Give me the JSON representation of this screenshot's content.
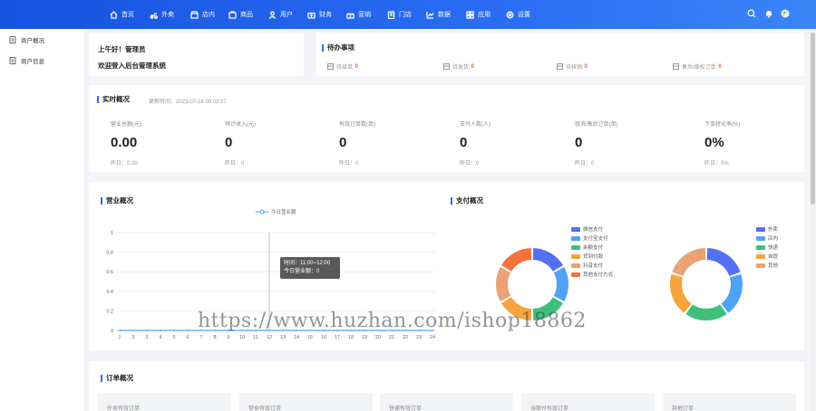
{
  "nav": {
    "items": [
      {
        "label": "首页",
        "icon": "home-icon"
      },
      {
        "label": "外卖",
        "icon": "delivery-icon"
      },
      {
        "label": "店内",
        "icon": "store-icon"
      },
      {
        "label": "商品",
        "icon": "goods-icon"
      },
      {
        "label": "用户",
        "icon": "user-icon"
      },
      {
        "label": "财务",
        "icon": "finance-icon"
      },
      {
        "label": "营销",
        "icon": "gift-icon"
      },
      {
        "label": "门店",
        "icon": "shop-icon"
      },
      {
        "label": "数据",
        "icon": "data-icon"
      },
      {
        "label": "应用",
        "icon": "apps-icon"
      },
      {
        "label": "设置",
        "icon": "gear-icon"
      }
    ],
    "right_icons": [
      "search-icon",
      "bell-icon",
      "avatar"
    ]
  },
  "sidebar": {
    "items": [
      {
        "label": "商户概况"
      },
      {
        "label": "商户信息"
      }
    ]
  },
  "welcome": {
    "line1": "上午好！管理员",
    "line2": "欢迎登入后台管理系统"
  },
  "todo": {
    "title": "待办事项",
    "items": [
      {
        "label": "待接单:",
        "value": "0"
      },
      {
        "label": "待发货:",
        "value": "0"
      },
      {
        "label": "待核销:",
        "value": "0"
      },
      {
        "label": "售后/维权订单:",
        "value": "0"
      }
    ]
  },
  "realtime": {
    "title": "实时概况",
    "update_time": "更新时间：2023-07-18 09:03:57",
    "stats": [
      {
        "label": "营业总额(元)",
        "value": "0.00",
        "compare": "昨日：0.00"
      },
      {
        "label": "预计收入(元)",
        "value": "0",
        "compare": "昨日：0"
      },
      {
        "label": "有效订单数(单)",
        "value": "0",
        "compare": "昨日：0"
      },
      {
        "label": "支付人数(人)",
        "value": "0",
        "compare": "昨日：0"
      },
      {
        "label": "取消/售后订单(单)",
        "value": "0",
        "compare": "昨日：0"
      },
      {
        "label": "下单转化率(%)",
        "value": "0%",
        "compare": "昨日：0%"
      }
    ]
  },
  "business": {
    "title": "营业概况",
    "legend": "今日营业额",
    "tooltip_time": "时间：11:00~12:00",
    "tooltip_value": "今日营业额：0"
  },
  "payment": {
    "title": "支付概况",
    "legend1": [
      {
        "label": "微信支付",
        "color": "#5470f2"
      },
      {
        "label": "支付宝支付",
        "color": "#4ea3f5"
      },
      {
        "label": "余额支付",
        "color": "#3ec07c"
      },
      {
        "label": "货到付款",
        "color": "#f5a33b"
      },
      {
        "label": "抖音支付",
        "color": "#e9a274"
      },
      {
        "label": "其他支付方式",
        "color": "#f5733b"
      }
    ],
    "legend2": [
      {
        "label": "外卖",
        "color": "#5470f2"
      },
      {
        "label": "店内",
        "color": "#4ea3f5"
      },
      {
        "label": "快递",
        "color": "#3ec07c"
      },
      {
        "label": "自提",
        "color": "#f5a33b"
      },
      {
        "label": "其他",
        "color": "#e9a274"
      }
    ]
  },
  "orders": {
    "title": "订单概况",
    "boxes": [
      "外卖有效订单",
      "堂食有效订单",
      "快递有效订单",
      "当面付有效订单",
      "其他订单"
    ]
  },
  "chart_data": {
    "type": "line",
    "x": [
      1,
      2,
      3,
      4,
      5,
      6,
      7,
      8,
      9,
      10,
      11,
      12,
      13,
      14,
      15,
      16,
      17,
      18,
      19,
      20,
      21,
      22,
      23,
      24
    ],
    "series": [
      {
        "name": "今日营业额",
        "values": [
          0,
          0,
          0,
          0,
          0,
          0,
          0,
          0,
          0,
          0,
          0,
          0,
          0,
          0,
          0,
          0,
          0,
          0,
          0,
          0,
          0,
          0,
          0,
          0
        ]
      }
    ],
    "ylim": [
      0,
      1
    ],
    "yticks": [
      "0",
      "0.2",
      "0.4",
      "0.6",
      "0.8",
      "1"
    ],
    "grid": true,
    "legend": "top"
  },
  "pie_data": [
    {
      "type": "pie",
      "values": [
        1,
        1,
        1,
        1,
        1,
        1
      ]
    },
    {
      "type": "pie",
      "values": [
        1,
        1,
        1,
        1,
        1
      ]
    }
  ],
  "watermark": "https://www.huzhan.com/ishop18862"
}
